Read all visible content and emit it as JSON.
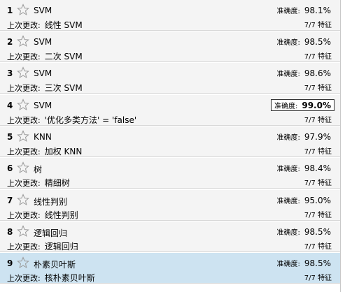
{
  "labels": {
    "last_change": "上次更改:",
    "accuracy": "准确度:",
    "features_suffix": "特征"
  },
  "models": [
    {
      "number": "1",
      "name": "SVM",
      "last_change": "线性 SVM",
      "accuracy": "98.1%",
      "features": "7/7",
      "best": false,
      "selected": false
    },
    {
      "number": "2",
      "name": "SVM",
      "last_change": "二次 SVM",
      "accuracy": "98.5%",
      "features": "7/7",
      "best": false,
      "selected": false
    },
    {
      "number": "3",
      "name": "SVM",
      "last_change": "三次 SVM",
      "accuracy": "98.6%",
      "features": "7/7",
      "best": false,
      "selected": false
    },
    {
      "number": "4",
      "name": "SVM",
      "last_change": "'优化多类方法' = 'false'",
      "accuracy": "99.0%",
      "features": "7/7",
      "best": true,
      "selected": false
    },
    {
      "number": "5",
      "name": "KNN",
      "last_change": "加权 KNN",
      "accuracy": "97.9%",
      "features": "7/7",
      "best": false,
      "selected": false
    },
    {
      "number": "6",
      "name": "树",
      "last_change": "精细树",
      "accuracy": "98.4%",
      "features": "7/7",
      "best": false,
      "selected": false
    },
    {
      "number": "7",
      "name": "线性判别",
      "last_change": "线性判别",
      "accuracy": "95.0%",
      "features": "7/7",
      "best": false,
      "selected": false
    },
    {
      "number": "8",
      "name": "逻辑回归",
      "last_change": "逻辑回归",
      "accuracy": "98.5%",
      "features": "7/7",
      "best": false,
      "selected": false
    },
    {
      "number": "9",
      "name": "朴素贝叶斯",
      "last_change": "核朴素贝叶斯",
      "accuracy": "98.5%",
      "features": "7/7",
      "best": false,
      "selected": true
    }
  ],
  "icons": {
    "favorite": "star-outline-icon"
  },
  "colors": {
    "row_background": "#f4f4f4",
    "selected_background": "#cde3f1",
    "best_border": "#333333"
  }
}
